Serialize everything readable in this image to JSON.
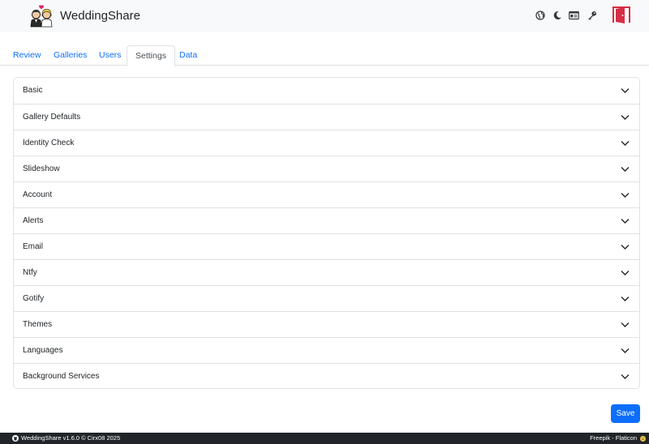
{
  "header": {
    "brand": "WeddingShare",
    "icons": [
      "globe-icon",
      "moon-icon",
      "id-card-icon",
      "key-icon",
      "exit-door-icon"
    ]
  },
  "tabs": [
    {
      "label": "Review",
      "active": false
    },
    {
      "label": "Galleries",
      "active": false
    },
    {
      "label": "Users",
      "active": false
    },
    {
      "label": "Settings",
      "active": true
    },
    {
      "label": "Data",
      "active": false
    }
  ],
  "accordion": [
    {
      "label": "Basic"
    },
    {
      "label": "Gallery Defaults"
    },
    {
      "label": "Identity Check"
    },
    {
      "label": "Slideshow"
    },
    {
      "label": "Account"
    },
    {
      "label": "Alerts"
    },
    {
      "label": "Email"
    },
    {
      "label": "Ntfy"
    },
    {
      "label": "Gotify"
    },
    {
      "label": "Themes"
    },
    {
      "label": "Languages"
    },
    {
      "label": "Background Services"
    }
  ],
  "save_label": "Save",
  "footer": {
    "left": "WeddingShare v1.6.0 © Cirx08 2025",
    "right": "Freepik - Flaticon"
  },
  "colors": {
    "accent": "#0d6efd",
    "header_bg": "#f8f9fa",
    "footer_bg": "#212529",
    "exit_icon": "#d62e45"
  }
}
